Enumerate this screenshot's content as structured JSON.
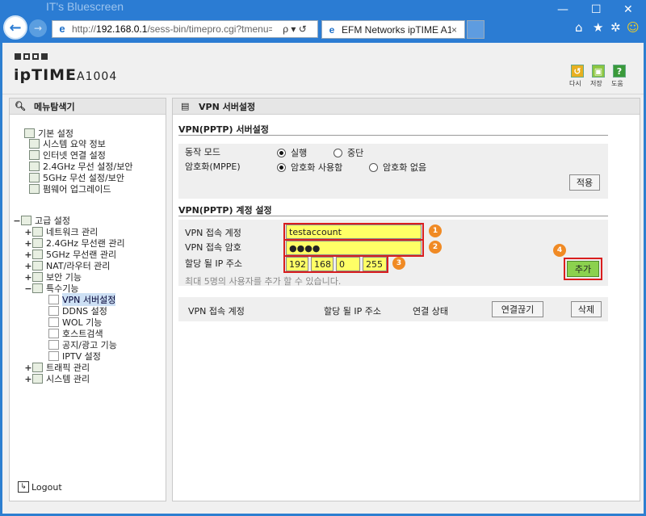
{
  "browser": {
    "watermark": "IT's Bluescreen",
    "url_prefix": "http://",
    "url_host": "192.168.0.1",
    "url_rest": "/sess-bin/timepro.cgi?tmenu=main_",
    "addr_controls": "ρ ▾ ↺",
    "tab_title": "EFM Networks ipTIME A10...",
    "tab_close": "×",
    "window_controls": [
      "—",
      "☐",
      "✕"
    ],
    "toolbar_icons": [
      "home-icon",
      "star-icon",
      "gear-icon",
      "smiley-icon"
    ]
  },
  "brand": {
    "logo_word": "ipTIME",
    "model": "A1004",
    "top_icons": [
      {
        "label": "다시",
        "color": "#e8b020"
      },
      {
        "label": "저장",
        "color": "#8cc63f"
      },
      {
        "label": "도움",
        "color": "#3a9a3a"
      }
    ]
  },
  "sidebar": {
    "title": "메뉴탐색기",
    "items": [
      {
        "label": "기본 설정",
        "toggle": ""
      },
      {
        "label": "시스템 요약 정보",
        "toggle": ""
      },
      {
        "label": "인터넷 연결 설정",
        "toggle": ""
      },
      {
        "label": "2.4GHz 무선 설정/보안",
        "toggle": ""
      },
      {
        "label": "5GHz 무선 설정/보안",
        "toggle": ""
      },
      {
        "label": "펌웨어 업그레이드",
        "toggle": ""
      },
      {
        "label": "고급 설정",
        "toggle": "−"
      },
      {
        "label": "네트워크 관리",
        "toggle": "+"
      },
      {
        "label": "2.4GHz 무선랜 관리",
        "toggle": "+"
      },
      {
        "label": "5GHz 무선랜 관리",
        "toggle": "+"
      },
      {
        "label": "NAT/라우터 관리",
        "toggle": "+"
      },
      {
        "label": "보안 기능",
        "toggle": "+"
      },
      {
        "label": "특수기능",
        "toggle": "−"
      },
      {
        "label": "VPN 서버설정",
        "toggle": ""
      },
      {
        "label": "DDNS 설정",
        "toggle": ""
      },
      {
        "label": "WOL 기능",
        "toggle": ""
      },
      {
        "label": "호스트검색",
        "toggle": ""
      },
      {
        "label": "공지/광고 기능",
        "toggle": ""
      },
      {
        "label": "IPTV 설정",
        "toggle": ""
      },
      {
        "label": "트래픽 관리",
        "toggle": "+"
      },
      {
        "label": "시스템 관리",
        "toggle": "+"
      }
    ],
    "logout": "Logout"
  },
  "content": {
    "title": "VPN 서버설정",
    "server_section": {
      "title": "VPN(PPTP) 서버설정",
      "mode_label": "동작 모드",
      "mode_on": "실행",
      "mode_off": "중단",
      "mppe_label": "암호화(MPPE)",
      "mppe_on": "암호화 사용함",
      "mppe_off": "암호화 없음",
      "apply_button": "적용"
    },
    "account_section": {
      "title": "VPN(PPTP) 계정 설정",
      "account_label": "VPN 접속 계정",
      "account_value": "testaccount",
      "password_label": "VPN 접속 암호",
      "password_value": "●●●●",
      "ip_label": "할당 될 IP 주소",
      "ip_octets": [
        "192",
        "168",
        "0",
        "255"
      ],
      "hint": "최대 5명의 사용자를 추가 할 수 있습니다.",
      "add_button": "추가",
      "badges": [
        "1",
        "2",
        "3",
        "4"
      ]
    },
    "list_header": {
      "col_account": "VPN 접속 계정",
      "col_ip": "할당 될 IP 주소",
      "col_status": "연결 상태",
      "disconnect_button": "연결끊기",
      "delete_button": "삭제"
    }
  }
}
